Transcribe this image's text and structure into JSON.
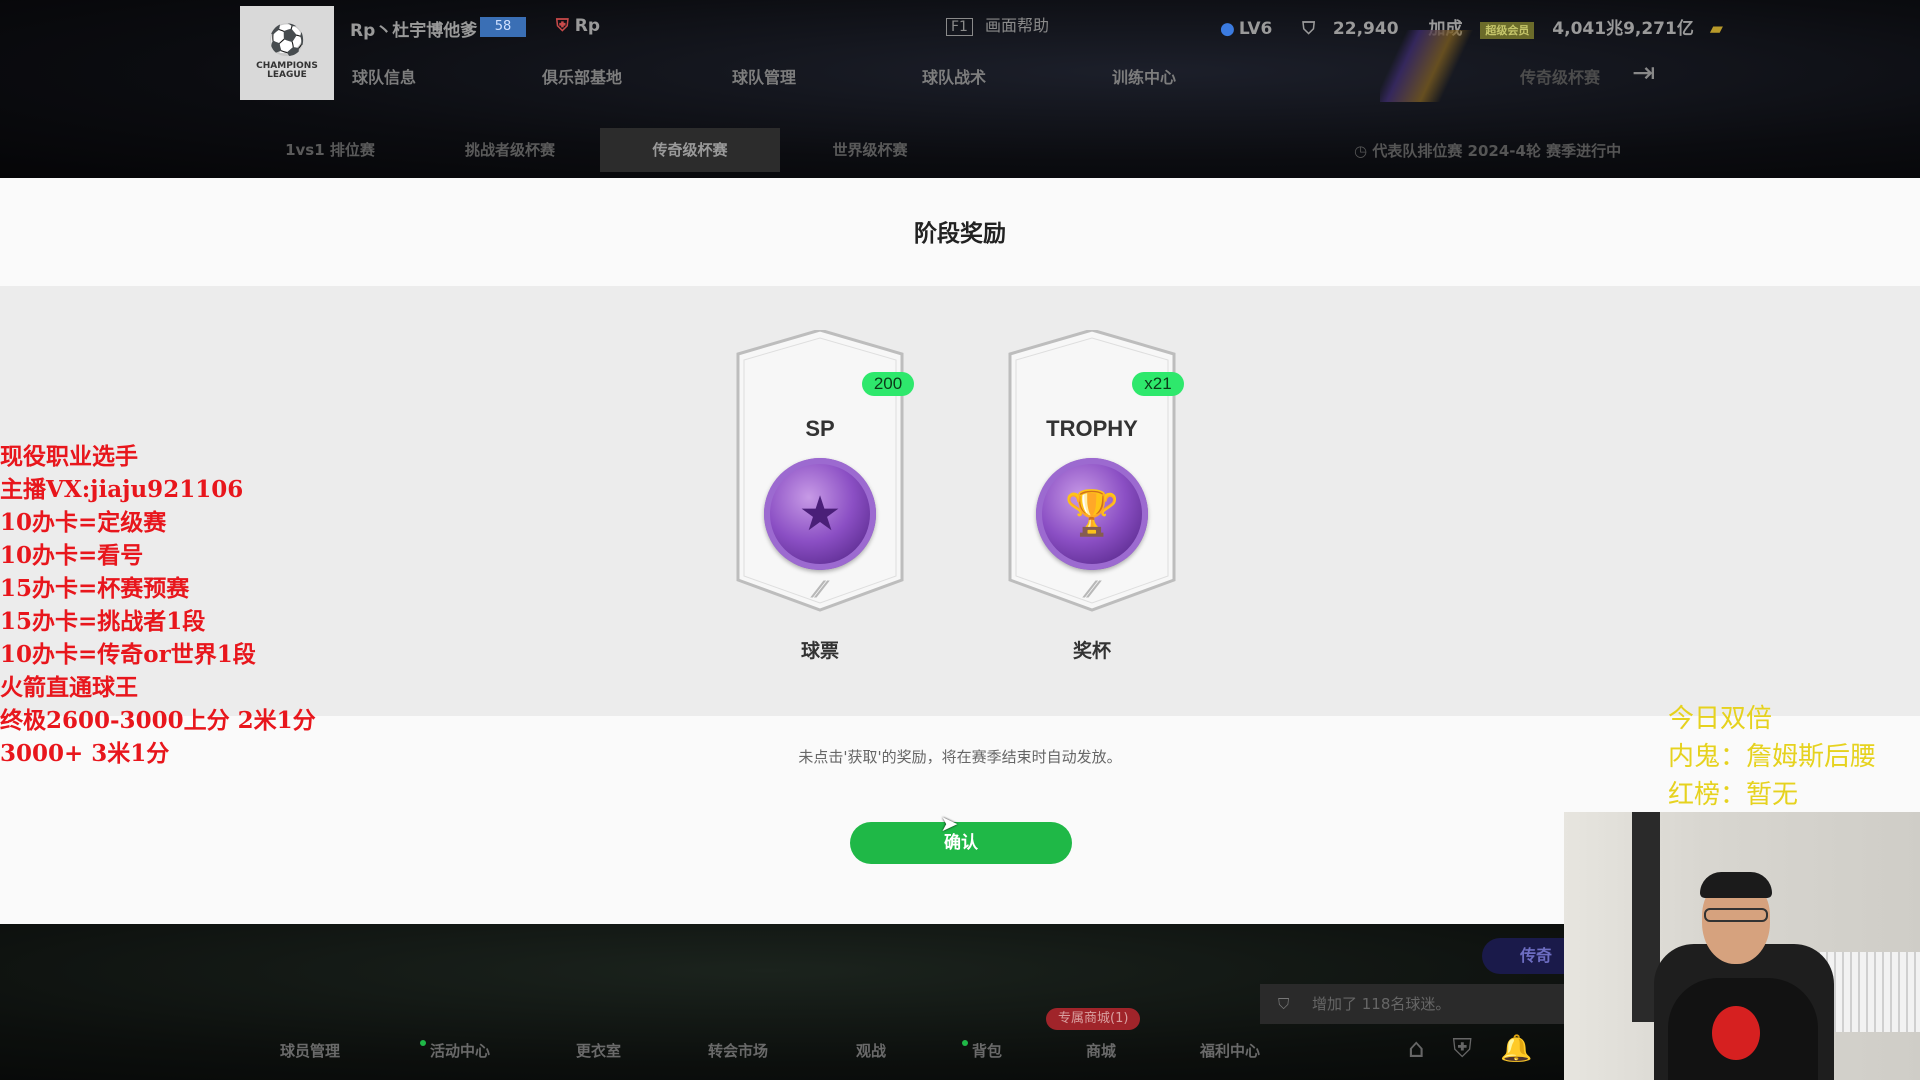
{
  "topbar": {
    "logo_text": "CHAMPIONS LEAGUE",
    "team_name": "Rp丶杜宇博他爹",
    "team_badge": "58",
    "team_tag": "Rp",
    "help_key": "F1",
    "help_label": "画面帮助",
    "level": "LV6",
    "points": "22,940",
    "bonus_label": "加成",
    "vip_label": "超级会员",
    "coins": "4,041兆9,271亿",
    "nav": [
      "球队信息",
      "俱乐部基地",
      "球队管理",
      "球队战术",
      "训练中心"
    ],
    "nav_right": "传奇级杯赛",
    "subtabs": [
      "1vs1 排位赛",
      "挑战者级杯赛",
      "传奇级杯赛",
      "世界级杯赛"
    ],
    "active_subtab": "传奇级杯赛",
    "season_info": "代表队排位赛 2024-4轮 赛季进行中"
  },
  "modal": {
    "title": "阶段奖励",
    "rewards": [
      {
        "label": "SP",
        "count": "200",
        "name": "球票",
        "icon": "star-coin-icon"
      },
      {
        "label": "TROPHY",
        "count": "x21",
        "name": "奖杯",
        "icon": "trophy-coin-icon"
      }
    ],
    "note": "未点击'获取'的奖励，将在赛季结束时自动发放。",
    "confirm_label": "确认"
  },
  "bottombar": {
    "legend_pill": "传奇",
    "info_text": "增加了 118名球迷。",
    "shop_badge": "专属商城(1)",
    "nav": [
      "球员管理",
      "活动中心",
      "更衣室",
      "转会市场",
      "观战",
      "背包",
      "商城",
      "福利中心"
    ]
  },
  "overlay": {
    "left_lines": [
      "现役职业选手",
      "主播VX:jiaju921106",
      "10办卡=定级赛",
      "10办卡=看号",
      "15办卡=杯赛预赛",
      "15办卡=挑战者1段",
      "10办卡=传奇or世界1段",
      "火箭直通球王",
      "终极2600-3000上分 2米1分",
      "3000+ 3米1分"
    ],
    "right_lines": [
      "今日双倍",
      "内鬼：詹姆斯后腰",
      "红榜：暂无"
    ]
  },
  "colors": {
    "accent_green": "#1fb847",
    "badge_green": "#2ee86c",
    "coin_purple": "#8b4fc4",
    "overlay_red": "#e8161c",
    "overlay_yellow": "#e6d21e"
  }
}
